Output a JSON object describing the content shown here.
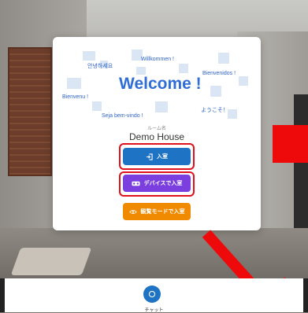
{
  "welcome": {
    "greetings": {
      "korean": "안녕하세요",
      "german": "Willkommen !",
      "spanish": "Bienvenidos !",
      "main": "Welcome !",
      "french": "Bienvenu !",
      "japanese": "ようこそ！",
      "portuguese": "Seja bem-vindo !"
    }
  },
  "room": {
    "label": "ルーム名",
    "name": "Demo House"
  },
  "buttons": {
    "enter": "入室",
    "device_enter": "デバイスで入室",
    "view_mode_enter": "観覧モードで入室"
  },
  "bottom": {
    "chat_label": "チャット"
  },
  "colors": {
    "enter": "#1e73c4",
    "device": "#7b3fe0",
    "view": "#f08a00",
    "highlight": "#e0101c",
    "welcome_text": "#2f6ed6"
  },
  "icons": {
    "enter": "login-icon",
    "device": "vr-headset-icon",
    "view": "eye-icon",
    "chat": "chat-bubble-icon"
  }
}
